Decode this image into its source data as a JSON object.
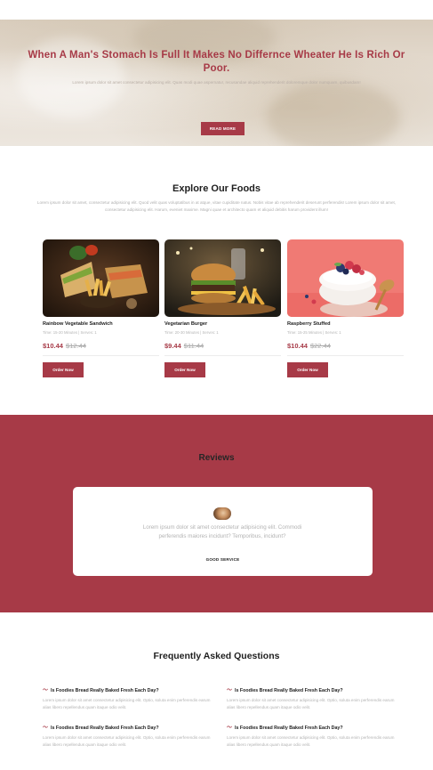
{
  "hero": {
    "title": "When A Man's Stomach Is Full It Makes No Differnce Wheater He Is Rich Or Poor.",
    "text": "Lorem ipsum dolor sit amet consectetur adipisicing elit. Quas modi quae aspernatur, recusandae aliquid reprehenderit doloremque dolor numquam, quibusdam!",
    "button_label": "READ MORE"
  },
  "explore": {
    "title": "Explore Our Foods",
    "text": "Lorem ipsum dolor sit amet, consectetur adipisicing elit. Quod velit quas voluptatibus in at atque, vitae cupiditate natus. Nobis vitae ab reprehenderit deserunt perferendis! Lorem ipsum dolor sit amet, consectetur adipisicing elit. Harum, eveniet maxime. Magni quae et architecto quam et aliquid debitis harum provident illum!",
    "cards": [
      {
        "name": "Rainbow Vegetable Sandwich",
        "meta": "Time: 15-20 Minutes | Serves: 1",
        "price": "$10.44",
        "old_price": "$12.44",
        "button_label": "Order Now"
      },
      {
        "name": "Vegetarian Burger",
        "meta": "Time: 20-30 Minutes | Serves: 1",
        "price": "$9.44",
        "old_price": "$11.44",
        "button_label": "Order Now"
      },
      {
        "name": "Raspberry Stuffed",
        "meta": "Time: 15-25 Minutes | Serves: 1",
        "price": "$10.44",
        "old_price": "$22.44",
        "button_label": "Order Now"
      }
    ]
  },
  "reviews": {
    "title": "Reviews",
    "text": "Lorem ipsum dolor sit amet consectetur adipisicing elit. Commodi perferendis maiores incidunt? Temporibus, incidunt?",
    "author": "GOOD SERVICE"
  },
  "faq": {
    "title": "Frequently Asked Questions",
    "items": [
      {
        "question": "Is Foodies Bread Really Baked Fresh Each Day?",
        "answer": "Lorem ipsum dolor sit amet consectetur adipisicing elit. Optio, soluta enim perferendis earum alias libero repellendus quam itaque odio velit."
      },
      {
        "question": "Is Foodies Bread Really Baked Fresh Each Day?",
        "answer": "Lorem ipsum dolor sit amet consectetur adipisicing elit. Optio, soluta enim perferendis earum alias libero repellendus quam itaque odio velit."
      },
      {
        "question": "Is Foodies Bread Really Baked Fresh Each Day?",
        "answer": "Lorem ipsum dolor sit amet consectetur adipisicing elit. Optio, soluta enim perferendis earum alias libero repellendus quam itaque odio velit."
      },
      {
        "question": "Is Foodies Bread Really Baked Fresh Each Day?",
        "answer": "Lorem ipsum dolor sit amet consectetur adipisicing elit. Optio, soluta enim perferendis earum alias libero repellendus quam itaque odio velit."
      }
    ]
  },
  "colors": {
    "accent": "#a73a47",
    "muted_text": "#b3b3b3",
    "heading": "#1e1e1e"
  },
  "icons": {
    "faq": "wave-icon"
  }
}
